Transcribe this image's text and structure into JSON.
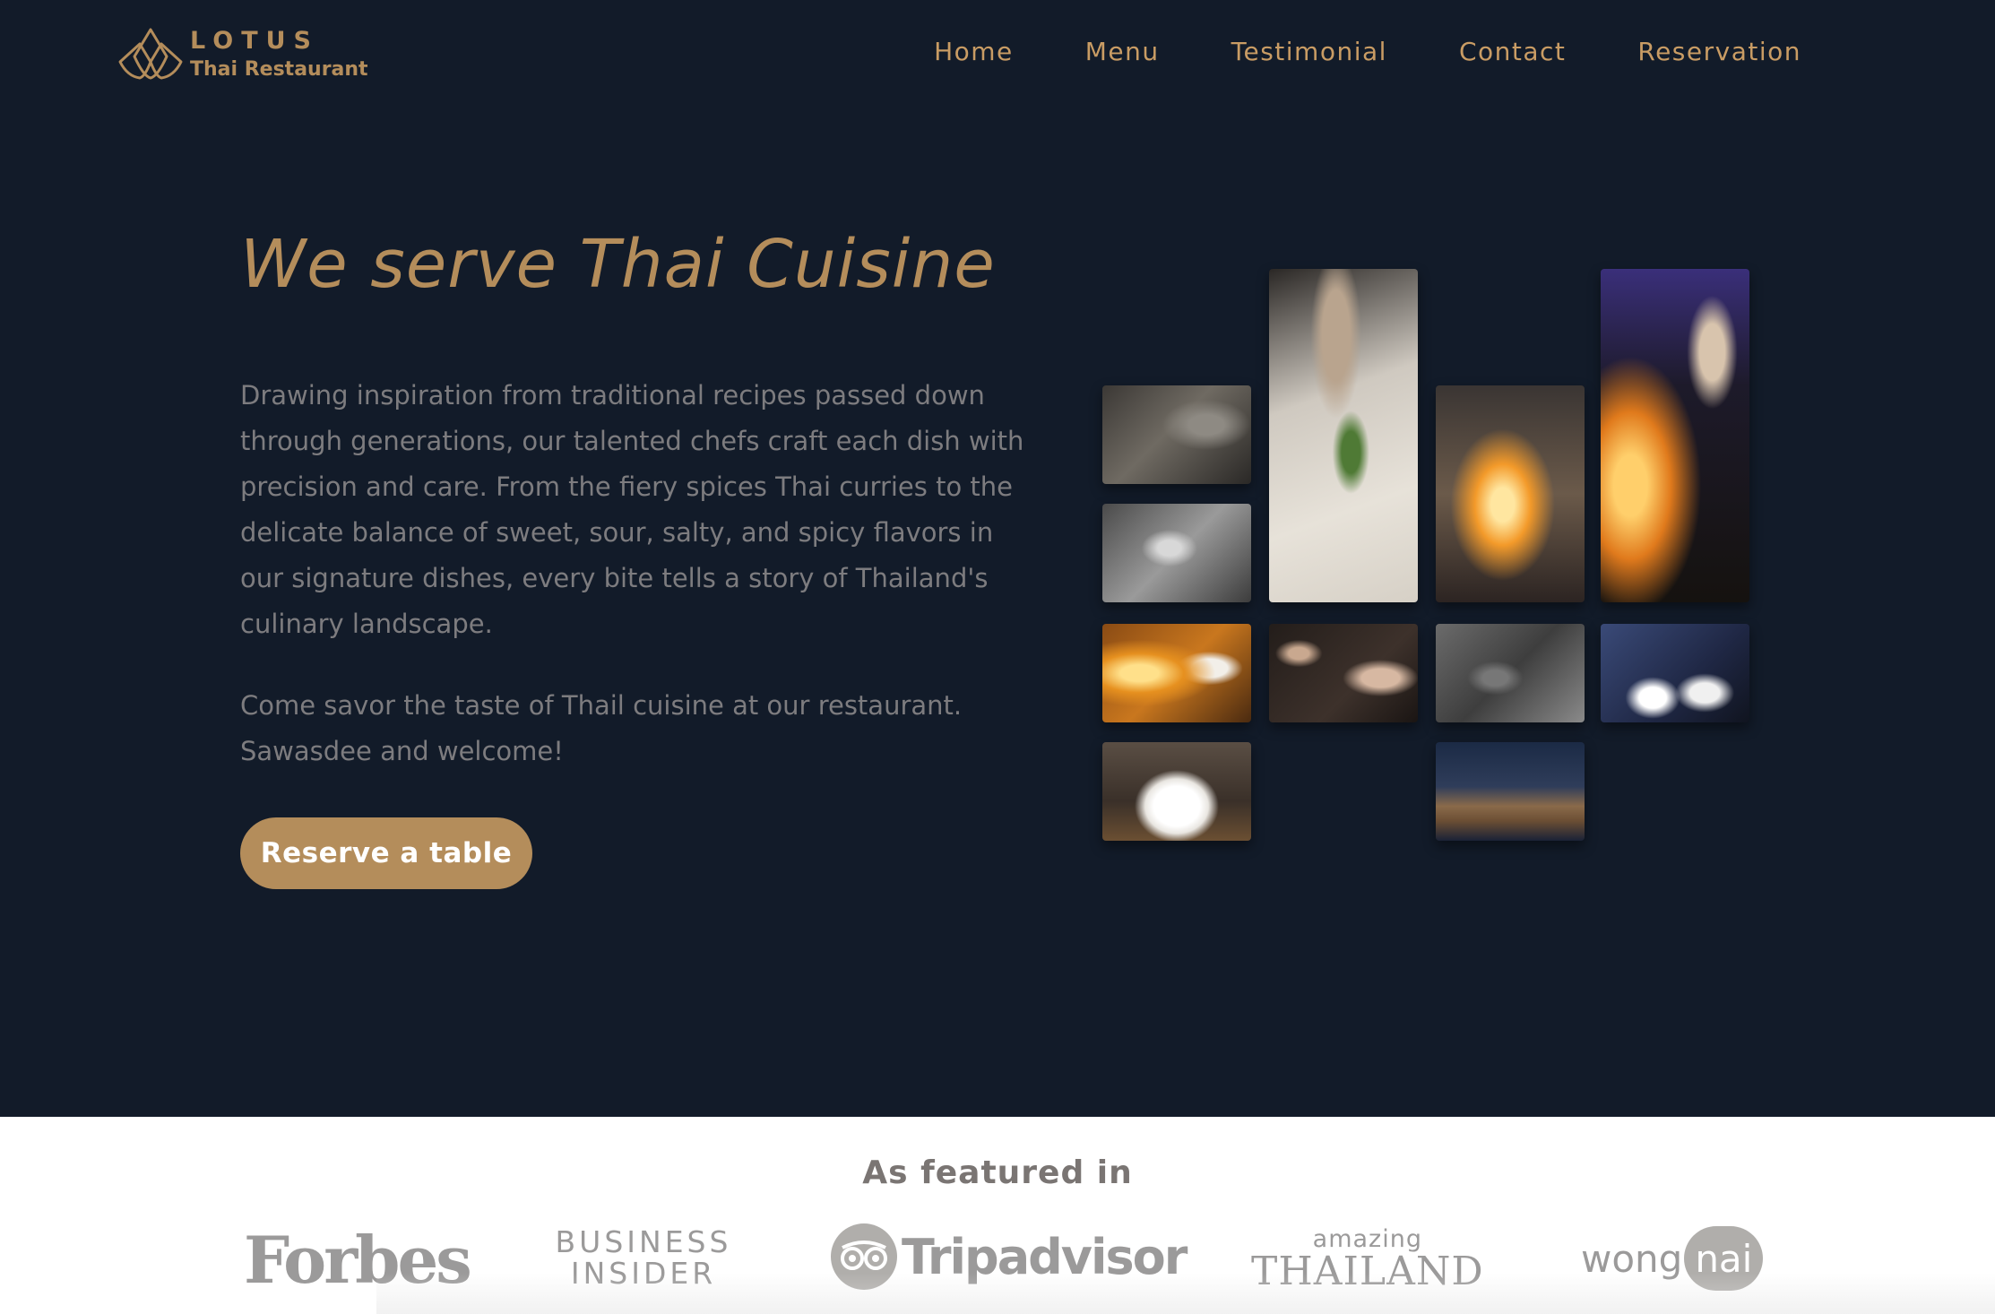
{
  "nav": {
    "logo": {
      "name": "LOTUS",
      "subtitle": "Thai Restaurant"
    },
    "items": [
      {
        "label": "Home"
      },
      {
        "label": "Menu"
      },
      {
        "label": "Testimonial"
      },
      {
        "label": "Contact"
      },
      {
        "label": "Reservation"
      }
    ]
  },
  "hero": {
    "title": "We serve Thai Cuisine",
    "paragraph1": "Drawing inspiration from traditional recipes passed down through generations, our talented chefs craft each dish with precision and care. From the fiery spices Thai curries to the delicate balance of sweet, sour, salty, and spicy flavors in our signature dishes, every bite tells a story of Thailand's culinary landscape.",
    "paragraph2": "Come savor the taste of Thail cuisine at our restaurant. Sawasdee and welcome!",
    "cta_label": "Reserve a table"
  },
  "gallery": {
    "images": [
      {
        "name": "kitchen-prep-photo"
      },
      {
        "name": "knife-chopping-herbs-photo"
      },
      {
        "name": "wok-flames-photo"
      },
      {
        "name": "chef-flambe-photo"
      },
      {
        "name": "chefs-cooking-bw-photo"
      },
      {
        "name": "chef-fire-stove-photo"
      },
      {
        "name": "hand-sprinkling-photo"
      },
      {
        "name": "chef-kitchen-bw-photo"
      },
      {
        "name": "plating-dishes-photo"
      },
      {
        "name": "pouring-sauce-photo"
      },
      {
        "name": "cutting-board-photo"
      }
    ]
  },
  "featured": {
    "title": "As featured in",
    "logos": {
      "forbes": "Forbes",
      "business_insider_1": "BUSINESS",
      "business_insider_2": "INSIDER",
      "tripadvisor": "Tripadvisor",
      "amazing": "amazing",
      "thailand": "THAILAND",
      "wong": "wong",
      "nai": "nai"
    }
  },
  "colors": {
    "background": "#121b29",
    "accent": "#b48d5b",
    "text_muted": "#7d7c7f",
    "logo_gray": "#9b9a9a"
  }
}
